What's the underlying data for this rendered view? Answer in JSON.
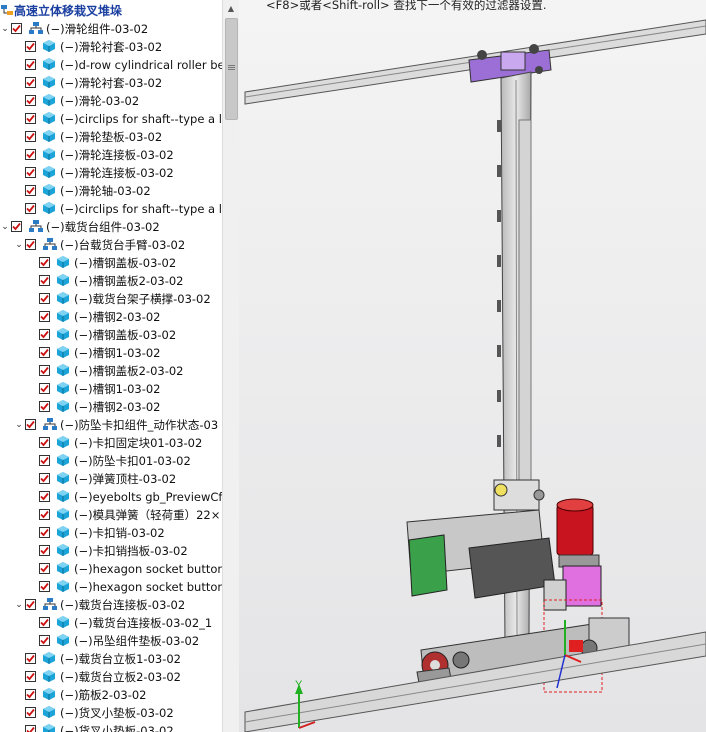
{
  "tree": {
    "root": {
      "label": "高速立体移栽叉堆垛"
    },
    "items": [
      {
        "label": "(−)滑轮组件-03-02",
        "level": 0,
        "type": "assembly",
        "expanded": true
      },
      {
        "label": "(−)滑轮衬套-03-02",
        "level": 1,
        "type": "part"
      },
      {
        "label": "(−)d-row cylindrical roller bear",
        "level": 1,
        "type": "part"
      },
      {
        "label": "(−)滑轮衬套-03-02",
        "level": 1,
        "type": "part"
      },
      {
        "label": "(−)滑轮-03-02",
        "level": 1,
        "type": "part"
      },
      {
        "label": "(−)circlips for shaft--type a lar",
        "level": 1,
        "type": "part"
      },
      {
        "label": "(−)滑轮垫板-03-02",
        "level": 1,
        "type": "part"
      },
      {
        "label": "(−)滑轮连接板-03-02",
        "level": 1,
        "type": "part"
      },
      {
        "label": "(−)滑轮连接板-03-02",
        "level": 1,
        "type": "part"
      },
      {
        "label": "(−)滑轮轴-03-02",
        "level": 1,
        "type": "part"
      },
      {
        "label": "(−)circlips for shaft--type a lar",
        "level": 1,
        "type": "part"
      },
      {
        "label": "(−)载货台组件-03-02",
        "level": 0,
        "type": "assembly",
        "expanded": true
      },
      {
        "label": "(−)台载货台手臂-03-02",
        "level": 1,
        "type": "assembly",
        "expanded": true
      },
      {
        "label": "(−)槽钢盖板-03-02",
        "level": 2,
        "type": "part"
      },
      {
        "label": "(−)槽钢盖板2-03-02",
        "level": 2,
        "type": "part"
      },
      {
        "label": "(−)载货台架子横撑-03-02",
        "level": 2,
        "type": "part"
      },
      {
        "label": "(−)槽钢2-03-02",
        "level": 2,
        "type": "part"
      },
      {
        "label": "(−)槽钢盖板-03-02",
        "level": 2,
        "type": "part"
      },
      {
        "label": "(−)槽钢1-03-02",
        "level": 2,
        "type": "part"
      },
      {
        "label": "(−)槽钢盖板2-03-02",
        "level": 2,
        "type": "part"
      },
      {
        "label": "(−)槽钢1-03-02",
        "level": 2,
        "type": "part"
      },
      {
        "label": "(−)槽钢2-03-02",
        "level": 2,
        "type": "part"
      },
      {
        "label": "(−)防坠卡扣组件_动作状态-03",
        "level": 1,
        "type": "assembly",
        "expanded": true
      },
      {
        "label": "(−)卡扣固定块01-03-02",
        "level": 2,
        "type": "part"
      },
      {
        "label": "(−)防坠卡扣01-03-02",
        "level": 2,
        "type": "part"
      },
      {
        "label": "(−)弹簧顶柱-03-02",
        "level": 2,
        "type": "part"
      },
      {
        "label": "(−)eyebolts gb_PreviewCfg-",
        "level": 2,
        "type": "part"
      },
      {
        "label": "(−)模具弹簧（轻荷重）22×",
        "level": 2,
        "type": "part"
      },
      {
        "label": "(−)卡扣销-03-02",
        "level": 2,
        "type": "part"
      },
      {
        "label": "(−)卡扣销挡板-03-02",
        "level": 2,
        "type": "part"
      },
      {
        "label": "(−)hexagon socket button h",
        "level": 2,
        "type": "part"
      },
      {
        "label": "(−)hexagon socket button h",
        "level": 2,
        "type": "part"
      },
      {
        "label": "(−)载货台连接板-03-02",
        "level": 1,
        "type": "assembly",
        "expanded": true
      },
      {
        "label": "(−)载货台连接板-03-02_1",
        "level": 2,
        "type": "part"
      },
      {
        "label": "(−)吊坠组件垫板-03-02",
        "level": 2,
        "type": "part"
      },
      {
        "label": "(−)载货台立板1-03-02",
        "level": 1,
        "type": "part"
      },
      {
        "label": "(−)载货台立板2-03-02",
        "level": 1,
        "type": "part"
      },
      {
        "label": "(−)筋板2-03-02",
        "level": 1,
        "type": "part"
      },
      {
        "label": "(−)货叉小垫板-03-02",
        "level": 1,
        "type": "part"
      },
      {
        "label": "(−)货叉小垫板-03-02",
        "level": 1,
        "type": "part"
      }
    ]
  },
  "viewport": {
    "hint": "<F8>或者<Shift-roll> 查找下一个有效的过滤器设置.",
    "triad": {
      "y_label": "Y"
    }
  },
  "colors": {
    "check": "#cc1111",
    "part_icon": "#1ca3d8",
    "assembly_icon": "#2b7bc4",
    "root_text": "#1a3fa0"
  }
}
